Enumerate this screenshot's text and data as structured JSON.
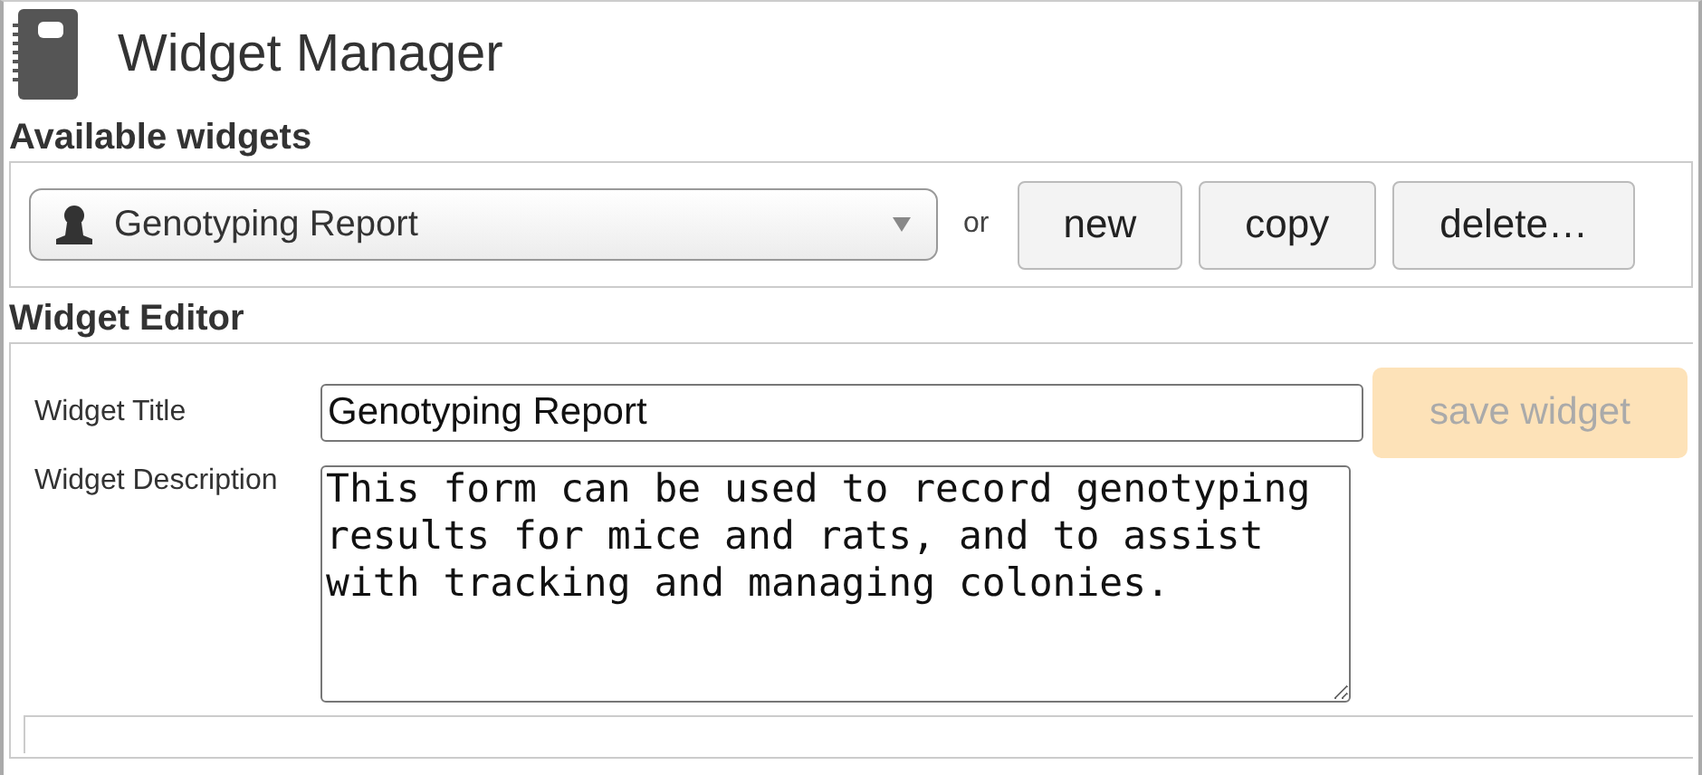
{
  "header": {
    "title": "Widget Manager"
  },
  "available": {
    "heading": "Available widgets",
    "selected_widget": "Genotyping Report",
    "separator": "or",
    "buttons": [
      {
        "label": "new"
      },
      {
        "label": "copy"
      },
      {
        "label": "delete…"
      }
    ]
  },
  "editor": {
    "heading": "Widget Editor",
    "title_label": "Widget Title",
    "title_value": "Genotyping Report",
    "save_button": {
      "label": "save widget",
      "disabled": true
    },
    "description_label": "Widget Description",
    "description_value": "This form can be used to record genotyping results for mice and rats, and to assist with tracking and managing colonies."
  }
}
